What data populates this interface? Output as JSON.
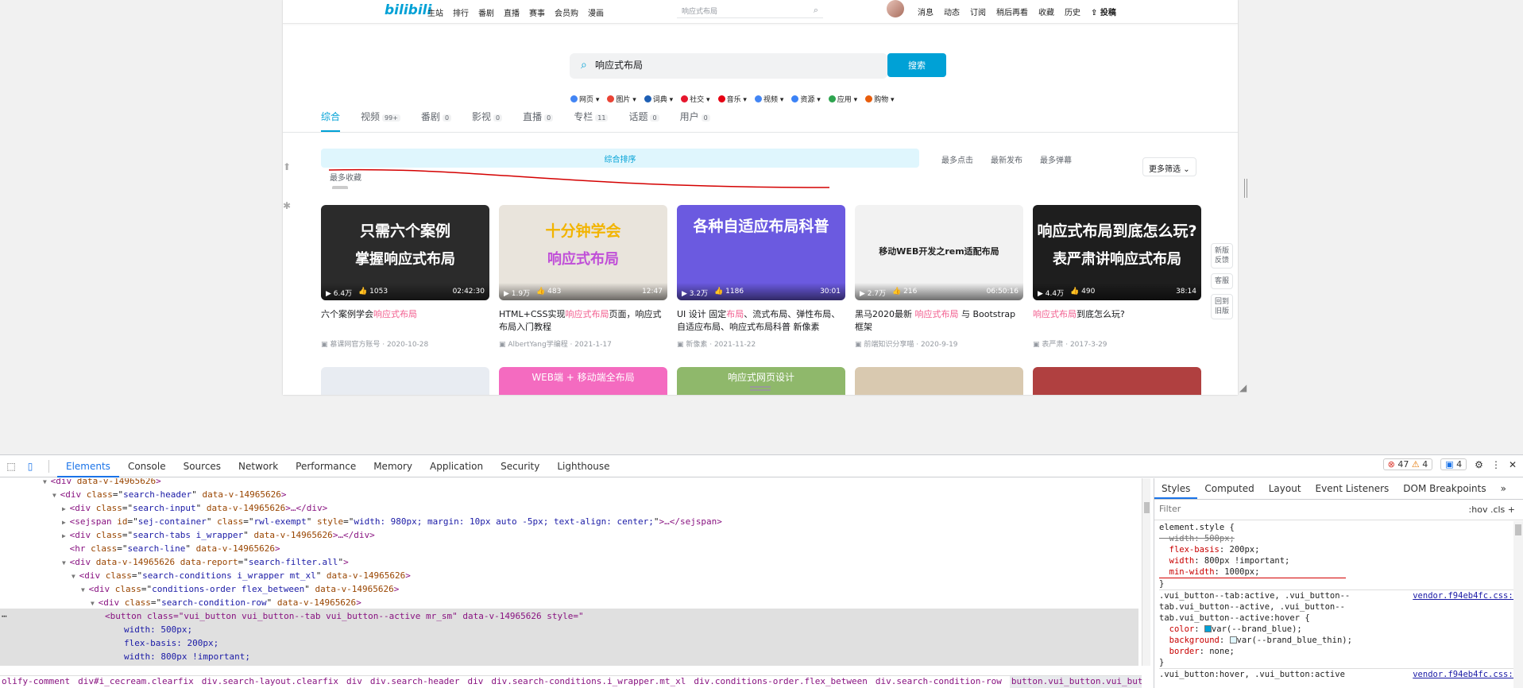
{
  "page": {
    "logo": "bilibili",
    "nav": [
      "主站",
      "排行",
      "番剧",
      "直播",
      "赛事",
      "会员购",
      "漫画"
    ],
    "top_search_placeholder": "响应式布局",
    "user_nav": [
      "消息",
      "动态",
      "订阅",
      "稍后再看",
      "收藏",
      "历史"
    ],
    "upload_label": "投稿",
    "search_query": "响应式布局",
    "search_button": "搜索",
    "ext_links": [
      "网页",
      "图片",
      "词典",
      "社交",
      "音乐",
      "视频",
      "资源",
      "应用",
      "购物"
    ],
    "tabs": [
      {
        "label": "综合",
        "count": ""
      },
      {
        "label": "视频",
        "count": "99+"
      },
      {
        "label": "番剧",
        "count": "0"
      },
      {
        "label": "影视",
        "count": "0"
      },
      {
        "label": "直播",
        "count": "0"
      },
      {
        "label": "专栏",
        "count": "11"
      },
      {
        "label": "话题",
        "count": "0"
      },
      {
        "label": "用户",
        "count": "0"
      }
    ],
    "order": {
      "active": "综合排序",
      "others": [
        "最多点击",
        "最新发布",
        "最多弹幕"
      ],
      "wrapped": "最多收藏",
      "more_filter": "更多筛选"
    },
    "cards": [
      {
        "thumb_text": [
          "只需六个案例",
          "掌握响应式布局"
        ],
        "views": "6.4万",
        "likes": "1053",
        "duration": "02:42:30",
        "title_plain": "六个案例学会",
        "title_hl": "响应式布局",
        "title_rest": "",
        "author": "慕课网官方账号",
        "date": "2020-10-28",
        "color": "#2b2b2b"
      },
      {
        "thumb_text": [
          "十分钟学会",
          "响应式布局"
        ],
        "views": "1.9万",
        "likes": "483",
        "duration": "12:47",
        "title_plain": "HTML+CSS实现",
        "title_hl": "响应式布局",
        "title_rest": "页面，响应式布局入门教程",
        "author": "AlbertYang学编程",
        "date": "2021-1-17",
        "color": "#e9e4dc"
      },
      {
        "thumb_text": [
          "各种自适应布局科普",
          ""
        ],
        "views": "3.2万",
        "likes": "1186",
        "duration": "30:01",
        "title_plain": "UI 设计 固定",
        "title_hl": "布局",
        "title_rest": "、流式布局、弹性布局、自适应布局、响应式布局科普 新像素",
        "author": "新像素",
        "date": "2021-11-22",
        "color": "#6b5ae0"
      },
      {
        "thumb_text": [
          "移动WEB开发之rem适配布局",
          ""
        ],
        "views": "2.7万",
        "likes": "216",
        "duration": "06:50:16",
        "title_plain": "黑马2020最新 ",
        "title_hl": "响应式布局",
        "title_rest": " 与 Bootstrap框架",
        "author": "前端知识分享喵",
        "date": "2020-9-19",
        "color": "#f2f2f2"
      },
      {
        "thumb_text": [
          "响应式布局到底怎么玩?",
          "表严肃讲响应式布局"
        ],
        "views": "4.4万",
        "likes": "490",
        "duration": "38:14",
        "title_plain": "",
        "title_hl": "响应式布局",
        "title_rest": "到底怎么玩?",
        "author": "表严肃",
        "date": "2017-3-29",
        "color": "#1e1e1e"
      }
    ],
    "row2": [
      "",
      "WEB端 + 移动端全布局",
      "响应式网页设计",
      "",
      ""
    ],
    "row2_colors": [
      "#e8ecf2",
      "#f46bc0",
      "#8fb86b",
      "#d9c9b0",
      "#b04040"
    ],
    "float_buttons": [
      "新版反馈",
      "客服",
      "回到旧版"
    ]
  },
  "devtools": {
    "tabs": [
      "Elements",
      "Console",
      "Sources",
      "Network",
      "Performance",
      "Memory",
      "Application",
      "Security",
      "Lighthouse"
    ],
    "errors": "47",
    "warnings": "4",
    "messages": "4",
    "elements_lines": [
      {
        "indent": 4,
        "arrow": "▼",
        "tag": "div",
        "attrs": [
          [
            "data-v-14965626",
            ""
          ]
        ],
        "tail": ""
      },
      {
        "indent": 5,
        "arrow": "▼",
        "tag": "div",
        "attrs": [
          [
            "class",
            "search-header"
          ],
          [
            "data-v-14965626",
            ""
          ]
        ],
        "tail": ""
      },
      {
        "indent": 6,
        "arrow": "▶",
        "tag": "div",
        "attrs": [
          [
            "class",
            "search-input"
          ],
          [
            "data-v-14965626",
            ""
          ]
        ],
        "tail": "…</div>"
      },
      {
        "indent": 6,
        "arrow": "▶",
        "tag": "sejspan",
        "attrs": [
          [
            "id",
            "sej-container"
          ],
          [
            "class",
            "rwl-exempt"
          ],
          [
            "style",
            "width: 980px; margin: 10px auto -5px; text-align: center;"
          ]
        ],
        "tail": "…</sejspan>"
      },
      {
        "indent": 6,
        "arrow": "▶",
        "tag": "div",
        "attrs": [
          [
            "class",
            "search-tabs i_wrapper"
          ],
          [
            "data-v-14965626",
            ""
          ]
        ],
        "tail": "…</div>"
      },
      {
        "indent": 6,
        "arrow": "",
        "tag": "hr",
        "attrs": [
          [
            "class",
            "search-line"
          ],
          [
            "data-v-14965626",
            ""
          ]
        ],
        "tail": ""
      },
      {
        "indent": 6,
        "arrow": "▼",
        "tag": "div",
        "attrs": [
          [
            "data-v-14965626",
            ""
          ],
          [
            "data-report",
            "search-filter.all"
          ]
        ],
        "tail": ""
      },
      {
        "indent": 7,
        "arrow": "▼",
        "tag": "div",
        "attrs": [
          [
            "class",
            "search-conditions i_wrapper mt_xl"
          ],
          [
            "data-v-14965626",
            ""
          ]
        ],
        "tail": ""
      },
      {
        "indent": 8,
        "arrow": "▼",
        "tag": "div",
        "attrs": [
          [
            "class",
            "conditions-order flex_between"
          ],
          [
            "data-v-14965626",
            ""
          ]
        ],
        "tail": ""
      },
      {
        "indent": 9,
        "arrow": "▼",
        "tag": "div",
        "attrs": [
          [
            "class",
            "search-condition-row"
          ],
          [
            "data-v-14965626",
            ""
          ]
        ],
        "tail": ""
      }
    ],
    "selected_open": "<button class=\"vui_button vui_button--tab vui_button--active mr_sm\" data-v-14965626 style=\"",
    "selected_styles": [
      "width: 500px;",
      "flex-basis: 200px;",
      "width: 800px !important;",
      "min-width: 1000px;"
    ],
    "breadcrumbs": [
      "olify-comment",
      "div#i_cecream.clearfix",
      "div.search-layout.clearfix",
      "div",
      "div.search-header",
      "div",
      "div.search-conditions.i_wrapper.mt_xl",
      "div.conditions-order.flex_between",
      "div.search-condition-row",
      "button.vui_button.vui_button--tab.vui_button--active.mr_sm"
    ],
    "styles_tabs": [
      "Styles",
      "Computed",
      "Layout",
      "Event Listeners",
      "DOM Breakpoints"
    ],
    "filter_placeholder": "Filter",
    "filter_opts": ":hov  .cls  +",
    "element_style_header": "element.style {",
    "element_style": [
      {
        "prop": "width",
        "value": "500px;",
        "struck": true
      },
      {
        "prop": "flex-basis",
        "value": "200px;",
        "struck": false
      },
      {
        "prop": "width",
        "value": "800px !important;",
        "struck": false
      },
      {
        "prop": "min-width",
        "value": "1000px;",
        "struck": false
      }
    ],
    "rule2_selector": ".vui_button--tab:active, .vui_button--tab.vui_button--active, .vui_button--tab.vui_button--active:hover",
    "rule2_source": "vendor.f94eb4fc.css:1",
    "rule2": [
      {
        "prop": "color",
        "value": "var(--brand_blue);"
      },
      {
        "prop": "background",
        "value": "var(--brand_blue_thin);"
      },
      {
        "prop": "border",
        "value": "none;"
      }
    ],
    "rule3_selector": ".vui_button:hover, .vui_button:active",
    "rule3_source": "vendor.f94eb4fc.css:1",
    "colors": {
      "brand_blue": "#00a1d6",
      "brand_blue_thin": "#dff6fd",
      "annotation": "#d40000"
    }
  }
}
